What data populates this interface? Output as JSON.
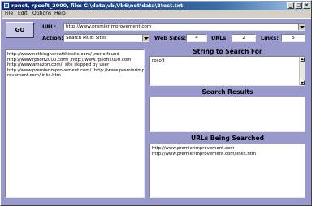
{
  "window": {
    "title": "rpnet, rpsoft_2000, file: C:\\data\\vb\\Vb6\\net\\data\\2test.txt",
    "minimize_label": "_",
    "maximize_label": "□",
    "close_label": "×"
  },
  "menu": {
    "file": "File",
    "edit": "Edit",
    "options": "Options",
    "help": "Help"
  },
  "toolbar": {
    "go_label": "GO",
    "url_label": "URL:",
    "url_value": "http://www.premierimprovement.com",
    "action_label": "Action::",
    "action_value": "Search Multi Sites",
    "web_sites_label": "Web Sites:",
    "web_sites_value": "4",
    "urls_label": "URLs:",
    "urls_value": "2",
    "links_label": "Links:",
    "links_value": "5"
  },
  "log": {
    "lines": [
      "http://www.nothinghereatthissite.com/ ,none found",
      "http://www.rpsoft2000.com/ ,http://www.rpsoft2000.com",
      "http://www.amazon.com/, site skipped by user",
      "http://www.premierimprovement.com/ ,http://www.premierimp",
      "rovement.com/links.htm"
    ]
  },
  "search_string": {
    "heading": "String to Search For",
    "value": "rpsoft"
  },
  "search_results": {
    "heading": "Search Results"
  },
  "urls_searched": {
    "heading": "URLs Being Searched",
    "lines": [
      "http://www.premierimprovement.com",
      "http://www.premierimprovement.com/links.htm"
    ]
  }
}
